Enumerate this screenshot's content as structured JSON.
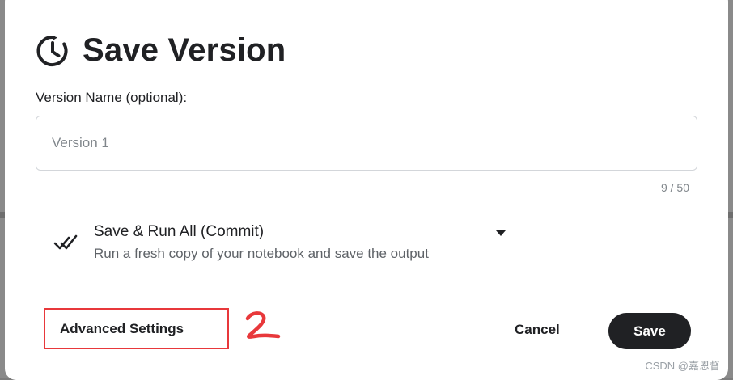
{
  "dialog": {
    "title": "Save Version",
    "title_icon": "history-clock-icon",
    "version_name": {
      "label": "Version Name (optional):",
      "placeholder": "Version 1",
      "value": "",
      "char_count": "9 / 50"
    },
    "save_mode": {
      "icon": "double-check-icon",
      "title": "Save & Run All (Commit)",
      "subtitle": "Run a fresh copy of your notebook and save the output",
      "dropdown_icon": "caret-down-icon"
    },
    "advanced_settings_label": "Advanced Settings",
    "annotation_mark": "2",
    "cancel_label": "Cancel",
    "save_label": "Save"
  },
  "watermark": "CSDN @嘉恩督",
  "colors": {
    "primary_button": "#202124",
    "highlight_border": "#e8383b",
    "dialog_background": "#ffffff"
  }
}
